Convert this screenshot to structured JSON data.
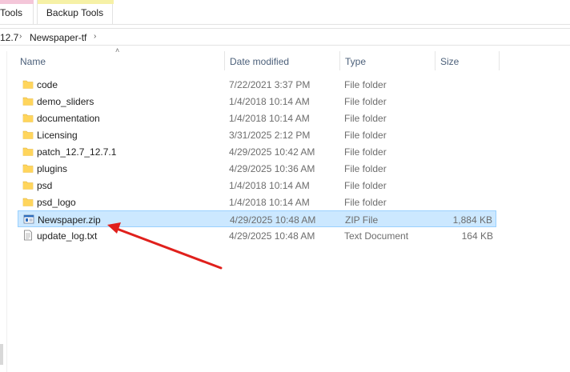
{
  "ribbon": {
    "tabs": [
      {
        "label": "Tools"
      },
      {
        "label": "Backup Tools"
      }
    ]
  },
  "address": {
    "crumbs": [
      "12.7",
      "Newspaper-tf"
    ]
  },
  "columns": {
    "name": "Name",
    "date": "Date modified",
    "type": "Type",
    "size": "Size"
  },
  "files": [
    {
      "name": "code",
      "date": "7/22/2021 3:37 PM",
      "type": "File folder",
      "size": "",
      "icon": "folder-icon"
    },
    {
      "name": "demo_sliders",
      "date": "1/4/2018 10:14 AM",
      "type": "File folder",
      "size": "",
      "icon": "folder-icon"
    },
    {
      "name": "documentation",
      "date": "1/4/2018 10:14 AM",
      "type": "File folder",
      "size": "",
      "icon": "folder-icon"
    },
    {
      "name": "Licensing",
      "date": "3/31/2025 2:12 PM",
      "type": "File folder",
      "size": "",
      "icon": "folder-icon"
    },
    {
      "name": "patch_12.7_12.7.1",
      "date": "4/29/2025 10:42 AM",
      "type": "File folder",
      "size": "",
      "icon": "folder-icon"
    },
    {
      "name": "plugins",
      "date": "4/29/2025 10:36 AM",
      "type": "File folder",
      "size": "",
      "icon": "folder-icon"
    },
    {
      "name": "psd",
      "date": "1/4/2018 10:14 AM",
      "type": "File folder",
      "size": "",
      "icon": "folder-icon"
    },
    {
      "name": "psd_logo",
      "date": "1/4/2018 10:14 AM",
      "type": "File folder",
      "size": "",
      "icon": "folder-icon"
    },
    {
      "name": "Newspaper.zip",
      "date": "4/29/2025 10:48 AM",
      "type": "ZIP File",
      "size": "1,884 KB",
      "icon": "zip-file-icon",
      "selected": true
    },
    {
      "name": "update_log.txt",
      "date": "4/29/2025 10:48 AM",
      "type": "Text Document",
      "size": "164 KB",
      "icon": "text-file-icon"
    }
  ],
  "colors": {
    "folder": "#ffd55c",
    "selection_bg": "#cce8ff",
    "selection_border": "#99d1ff",
    "annotation_arrow": "#e0201c",
    "header_text": "#4c607a"
  }
}
